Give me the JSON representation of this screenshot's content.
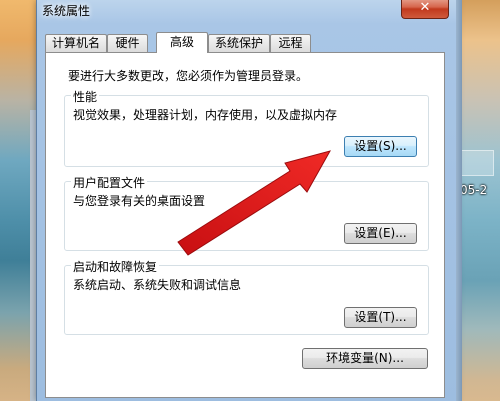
{
  "window": {
    "title": "系统属性",
    "close_label": "✕"
  },
  "tabs": [
    {
      "label": "计算机名"
    },
    {
      "label": "硬件"
    },
    {
      "label": "高级",
      "active": true
    },
    {
      "label": "系统保护"
    },
    {
      "label": "远程"
    }
  ],
  "notice": "要进行大多数更改，您必须作为管理员登录。",
  "performance": {
    "title": "性能",
    "desc": "视觉效果，处理器计划，内存使用，以及虚拟内存",
    "button": "设置(S)..."
  },
  "user_profile": {
    "title": "用户配置文件",
    "desc": "与您登录有关的桌面设置",
    "button": "设置(E)..."
  },
  "startup": {
    "title": "启动和故障恢复",
    "desc": "系统启动、系统失败和调试信息",
    "button": "设置(T)..."
  },
  "env_button": "环境变量(N)...",
  "desktop_text": "05-2",
  "colors": {
    "arrow": "#e0171b",
    "close": "#c1391d"
  }
}
